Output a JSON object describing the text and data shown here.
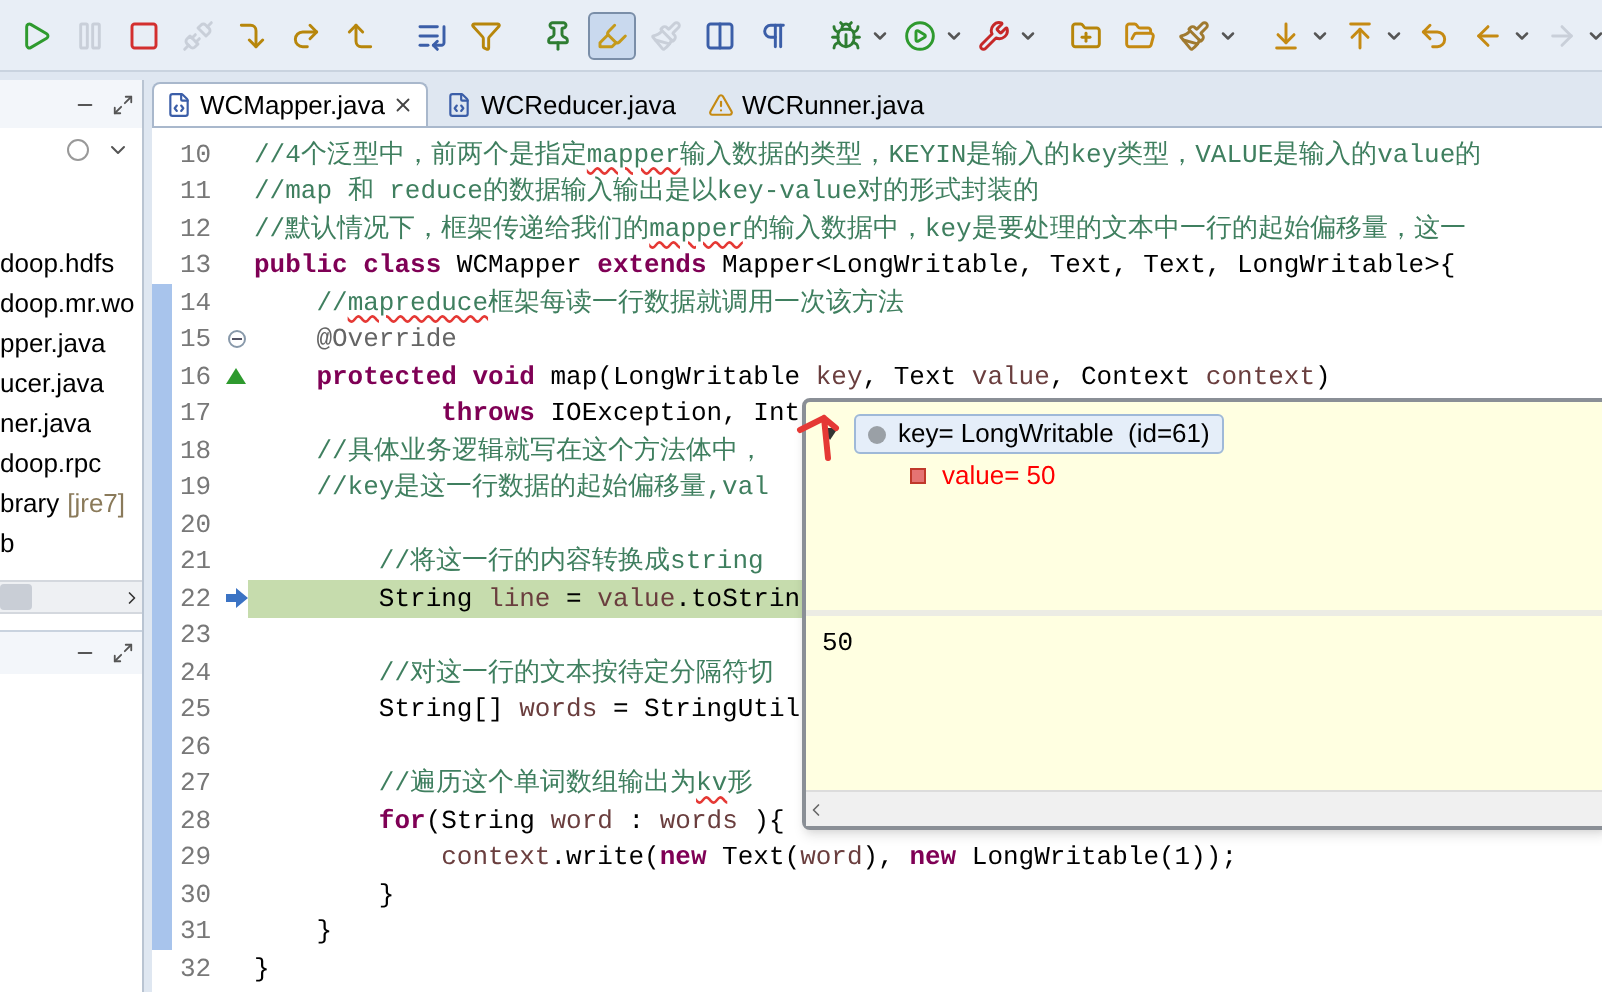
{
  "toolbar": [
    {
      "kind": "resume",
      "disabled": false,
      "pressed": false,
      "dropdown": false
    },
    {
      "kind": "suspend",
      "disabled": true,
      "pressed": false,
      "dropdown": false
    },
    {
      "kind": "terminate",
      "disabled": false,
      "pressed": false,
      "dropdown": false
    },
    {
      "kind": "disconnect",
      "disabled": true,
      "pressed": false,
      "dropdown": false
    },
    {
      "kind": "step-into",
      "disabled": false,
      "pressed": false,
      "dropdown": false
    },
    {
      "kind": "step-over",
      "disabled": false,
      "pressed": false,
      "dropdown": false
    },
    {
      "kind": "step-return",
      "disabled": false,
      "pressed": false,
      "dropdown": false
    },
    {
      "kind": "separator"
    },
    {
      "kind": "drop-frame",
      "disabled": false,
      "pressed": false,
      "dropdown": false
    },
    {
      "kind": "step-filter",
      "disabled": false,
      "pressed": false,
      "dropdown": false
    },
    {
      "kind": "separator"
    },
    {
      "kind": "new-breakpoint",
      "disabled": false,
      "pressed": false,
      "dropdown": false
    },
    {
      "kind": "highlight",
      "disabled": false,
      "pressed": true,
      "dropdown": false
    },
    {
      "kind": "occurrences",
      "disabled": true,
      "pressed": false,
      "dropdown": false
    },
    {
      "kind": "block-select",
      "disabled": false,
      "pressed": false,
      "dropdown": false
    },
    {
      "kind": "whitespace",
      "disabled": false,
      "pressed": false,
      "dropdown": false
    },
    {
      "kind": "separator"
    },
    {
      "kind": "debug",
      "disabled": false,
      "pressed": false,
      "dropdown": true
    },
    {
      "kind": "run",
      "disabled": false,
      "pressed": false,
      "dropdown": true
    },
    {
      "kind": "external-tool",
      "disabled": false,
      "pressed": false,
      "dropdown": true
    },
    {
      "kind": "separator"
    },
    {
      "kind": "new-project",
      "disabled": false,
      "pressed": false,
      "dropdown": false
    },
    {
      "kind": "open-folder",
      "disabled": false,
      "pressed": false,
      "dropdown": false
    },
    {
      "kind": "brush",
      "disabled": false,
      "pressed": false,
      "dropdown": true
    },
    {
      "kind": "separator"
    },
    {
      "kind": "next-annotation",
      "disabled": false,
      "pressed": false,
      "dropdown": true
    },
    {
      "kind": "previous-annotation",
      "disabled": false,
      "pressed": false,
      "dropdown": true
    },
    {
      "kind": "last-edit",
      "disabled": false,
      "pressed": false,
      "dropdown": false
    },
    {
      "kind": "back",
      "disabled": false,
      "pressed": false,
      "dropdown": true
    },
    {
      "kind": "forward",
      "disabled": true,
      "pressed": false,
      "dropdown": true
    }
  ],
  "explorer": {
    "items": [
      {
        "text": "doop.hdfs"
      },
      {
        "text": "doop.mr.wo"
      },
      {
        "text": "pper.java"
      },
      {
        "text": "ucer.java"
      },
      {
        "text": "ner.java"
      },
      {
        "text": "doop.rpc"
      },
      {
        "text": "brary",
        "suffix": "[jre7]"
      },
      {
        "text": "b"
      }
    ]
  },
  "tabs": [
    {
      "label": "WCMapper.java",
      "selected": true,
      "warning": false
    },
    {
      "label": "WCReducer.java",
      "selected": false,
      "warning": false
    },
    {
      "label": "WCRunner.java",
      "selected": false,
      "warning": true
    }
  ],
  "lines": [
    {
      "number": "10",
      "current": false,
      "fold": false,
      "override": false,
      "segments": [
        {
          "kind": "comment",
          "text": "//4个泛型中，前两个是指定"
        },
        {
          "kind": "misspelled",
          "text": "mapper"
        },
        {
          "kind": "comment",
          "text": "输入数据的类型，KEYIN是输入的key类型，VALUE是输入的value的"
        }
      ]
    },
    {
      "number": "11",
      "current": false,
      "fold": false,
      "override": false,
      "segments": [
        {
          "kind": "comment",
          "text": "//map 和 reduce的数据输入输出是以key-value对的形式封装的"
        }
      ]
    },
    {
      "number": "12",
      "current": false,
      "fold": false,
      "override": false,
      "segments": [
        {
          "kind": "comment",
          "text": "//默认情况下，框架传递给我们的"
        },
        {
          "kind": "misspelled",
          "text": "mapper"
        },
        {
          "kind": "comment",
          "text": "的输入数据中，key是要处理的文本中一行的起始偏移量，这一"
        }
      ]
    },
    {
      "number": "13",
      "current": false,
      "fold": false,
      "override": false,
      "segments": [
        {
          "kind": "keyword",
          "text": "public class"
        },
        {
          "kind": "plain",
          "text": " WCMapper "
        },
        {
          "kind": "keyword",
          "text": "extends"
        },
        {
          "kind": "plain",
          "text": " Mapper<LongWritable, Text, Text, LongWritable>{"
        }
      ]
    },
    {
      "number": "14",
      "current": false,
      "fold": false,
      "override": false,
      "segments": [
        {
          "kind": "comment",
          "text": "    //"
        },
        {
          "kind": "misspelled",
          "text": "mapreduce"
        },
        {
          "kind": "comment",
          "text": "框架每读一行数据就调用一次该方法"
        }
      ]
    },
    {
      "number": "15",
      "current": false,
      "fold": true,
      "override": false,
      "segments": [
        {
          "kind": "annotation",
          "text": "    @Override"
        }
      ]
    },
    {
      "number": "16",
      "current": false,
      "fold": false,
      "override": true,
      "segments": [
        {
          "kind": "keyword",
          "text": "    protected void"
        },
        {
          "kind": "plain",
          "text": " map(LongWritable "
        },
        {
          "kind": "variable",
          "text": "key"
        },
        {
          "kind": "plain",
          "text": ", Text "
        },
        {
          "kind": "variable",
          "text": "value"
        },
        {
          "kind": "plain",
          "text": ", Context "
        },
        {
          "kind": "variable",
          "text": "context"
        },
        {
          "kind": "plain",
          "text": ")"
        }
      ]
    },
    {
      "number": "17",
      "current": false,
      "fold": false,
      "override": false,
      "segments": [
        {
          "kind": "keyword",
          "text": "            throws"
        },
        {
          "kind": "plain",
          "text": " IOException, Int"
        }
      ]
    },
    {
      "number": "18",
      "current": false,
      "fold": false,
      "override": false,
      "segments": [
        {
          "kind": "comment",
          "text": "    //具体业务逻辑就写在这个方法体中，"
        }
      ]
    },
    {
      "number": "19",
      "current": false,
      "fold": false,
      "override": false,
      "segments": [
        {
          "kind": "comment",
          "text": "    //key是这一行数据的起始偏移量,val"
        }
      ]
    },
    {
      "number": "20",
      "current": false,
      "fold": false,
      "override": false
    },
    {
      "number": "21",
      "current": false,
      "fold": false,
      "override": false,
      "segments": [
        {
          "kind": "comment",
          "text": "        //将这一行的内容转换成string"
        }
      ]
    },
    {
      "number": "22",
      "current": true,
      "fold": false,
      "override": false,
      "segments": [
        {
          "kind": "plain",
          "text": "        String "
        },
        {
          "kind": "variable",
          "text": "line"
        },
        {
          "kind": "plain",
          "text": " = "
        },
        {
          "kind": "variable",
          "text": "value"
        },
        {
          "kind": "plain",
          "text": ".toStrin"
        }
      ]
    },
    {
      "number": "23",
      "current": false,
      "fold": false,
      "override": false
    },
    {
      "number": "24",
      "current": false,
      "fold": false,
      "override": false,
      "segments": [
        {
          "kind": "comment",
          "text": "        //对这一行的文本按待定分隔符切"
        }
      ]
    },
    {
      "number": "25",
      "current": false,
      "fold": false,
      "override": false,
      "segments": [
        {
          "kind": "plain",
          "text": "        String[] "
        },
        {
          "kind": "variable",
          "text": "words"
        },
        {
          "kind": "plain",
          "text": " = StringUtil"
        }
      ]
    },
    {
      "number": "26",
      "current": false,
      "fold": false,
      "override": false
    },
    {
      "number": "27",
      "current": false,
      "fold": false,
      "override": false,
      "segments": [
        {
          "kind": "comment",
          "text": "        //遍历这个单词数组输出为"
        },
        {
          "kind": "misspelled",
          "text": "kv"
        },
        {
          "kind": "comment",
          "text": "形"
        }
      ]
    },
    {
      "number": "28",
      "current": false,
      "fold": false,
      "override": false,
      "segments": [
        {
          "kind": "keyword",
          "text": "        for"
        },
        {
          "kind": "plain",
          "text": "(String "
        },
        {
          "kind": "variable",
          "text": "word"
        },
        {
          "kind": "plain",
          "text": " : "
        },
        {
          "kind": "variable",
          "text": "words"
        },
        {
          "kind": "plain",
          "text": " ){"
        }
      ]
    },
    {
      "number": "29",
      "current": false,
      "fold": false,
      "override": false,
      "segments": [
        {
          "kind": "variable",
          "text": "            context"
        },
        {
          "kind": "plain",
          "text": ".write("
        },
        {
          "kind": "keyword",
          "text": "new"
        },
        {
          "kind": "plain",
          "text": " Text("
        },
        {
          "kind": "variable",
          "text": "word"
        },
        {
          "kind": "plain",
          "text": "), "
        },
        {
          "kind": "keyword",
          "text": "new"
        },
        {
          "kind": "plain",
          "text": " LongWritable(1));"
        }
      ]
    },
    {
      "number": "30",
      "current": false,
      "fold": false,
      "override": false,
      "segments": [
        {
          "kind": "plain",
          "text": "        }"
        }
      ]
    },
    {
      "number": "31",
      "current": false,
      "fold": false,
      "override": false,
      "segments": [
        {
          "kind": "plain",
          "text": "    }"
        }
      ]
    },
    {
      "number": "32",
      "current": false,
      "fold": false,
      "override": false,
      "segments": [
        {
          "kind": "plain",
          "text": "}"
        }
      ]
    }
  ],
  "inspect_popup": {
    "variables": [
      {
        "text": "key= LongWritable  (id=61)",
        "selected": true,
        "changed": false,
        "expanded": true,
        "children": [
          {
            "text": "value= 50",
            "selected": false,
            "changed": true
          }
        ]
      }
    ],
    "detail": "50"
  }
}
